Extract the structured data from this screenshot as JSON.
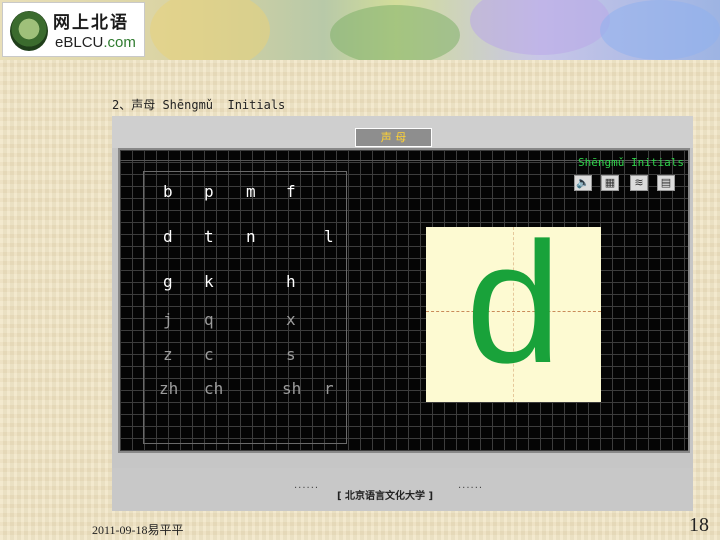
{
  "header": {
    "logo_cn": "网上北语",
    "logo_en_prefix": "eBLCU",
    "logo_en_suffix": ".com"
  },
  "slide_title": "2、声母 Shēngmǔ  Initials",
  "app": {
    "tab_label": "声 母",
    "board_caption": "Shēngmǔ Initials",
    "toolbar_icons": [
      "speaker-icon",
      "card-icon",
      "wave-icon",
      "grid-icon"
    ],
    "letters": [
      {
        "text": "b",
        "dim": false
      },
      {
        "text": "p",
        "dim": false
      },
      {
        "text": "m",
        "dim": false
      },
      {
        "text": "f",
        "dim": false
      },
      {
        "text": "d",
        "dim": false
      },
      {
        "text": "t",
        "dim": false
      },
      {
        "text": "n",
        "dim": false
      },
      {
        "text": "l",
        "dim": false
      },
      {
        "text": "g",
        "dim": false
      },
      {
        "text": "k",
        "dim": false
      },
      {
        "text": "h",
        "dim": false
      },
      {
        "text": "j",
        "dim": true
      },
      {
        "text": "q",
        "dim": true
      },
      {
        "text": "x",
        "dim": true
      },
      {
        "text": "z",
        "dim": true
      },
      {
        "text": "c",
        "dim": true
      },
      {
        "text": "s",
        "dim": true
      },
      {
        "text": "zh",
        "dim": true
      },
      {
        "text": "ch",
        "dim": true
      },
      {
        "text": "sh",
        "dim": true
      },
      {
        "text": "r",
        "dim": true
      }
    ],
    "featured_letter": "d",
    "featured_color": "#19a23a",
    "footer_text": "[ 北京语言文化大学 ]",
    "footer_dots": "······"
  },
  "slide_footer": {
    "date": "2011-09-18易平平",
    "page": "18"
  }
}
